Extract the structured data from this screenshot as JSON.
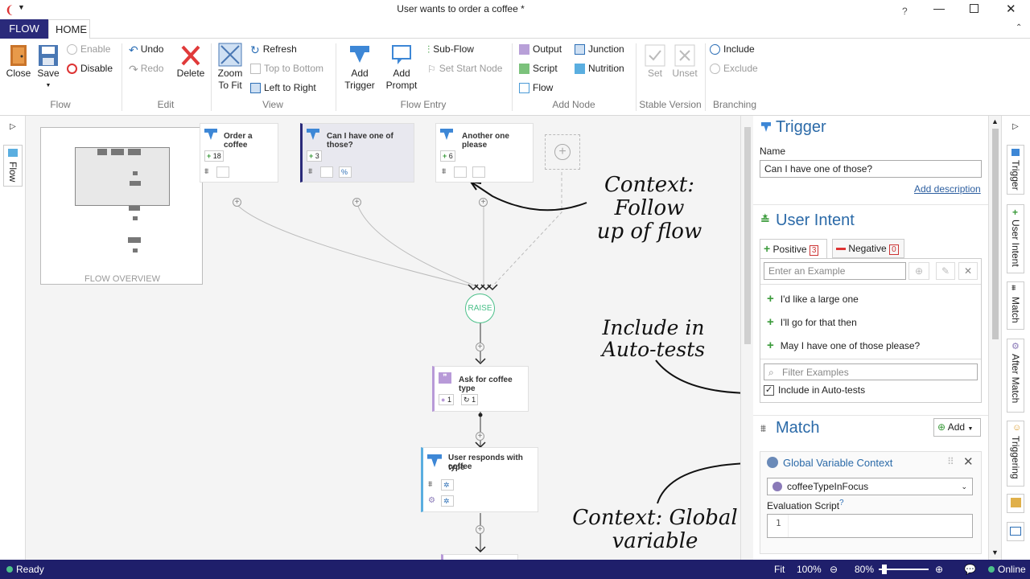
{
  "window": {
    "title": "User wants to order a coffee *"
  },
  "ribbon_tabs": [
    "FLOW",
    "HOME"
  ],
  "ribbon": {
    "close": "Close",
    "save": "Save",
    "enable": "Enable",
    "disable": "Disable",
    "undo": "Undo",
    "redo": "Redo",
    "delete": "Delete",
    "zoom_to_fit": [
      "Zoom",
      "To Fit"
    ],
    "refresh": "Refresh",
    "top_to_bottom": "Top to Bottom",
    "left_to_right": "Left to Right",
    "add_trigger": [
      "Add",
      "Trigger"
    ],
    "add_prompt": [
      "Add",
      "Prompt"
    ],
    "sub_flow": "Sub-Flow",
    "set_start_node": "Set Start Node",
    "output": "Output",
    "script": "Script",
    "flow": "Flow",
    "junction": "Junction",
    "nutrition": "Nutrition",
    "set": "Set",
    "unset": "Unset",
    "include": "Include",
    "exclude": "Exclude",
    "groups": [
      "Flow",
      "Edit",
      "View",
      "Flow Entry",
      "Add Node",
      "Stable Version",
      "Branching"
    ]
  },
  "left_rail": {
    "flow_tab": "Flow"
  },
  "overview": {
    "label": "FLOW OVERVIEW"
  },
  "nodes": {
    "trigger1": {
      "title": "Order a coffee",
      "count": "18"
    },
    "trigger2": {
      "title": "Can I have one of those?",
      "count": "3"
    },
    "trigger3": {
      "title": "Another one please",
      "count": "6"
    },
    "raise": "RAISE",
    "prompt": {
      "title": "Ask for coffee type",
      "a": "1",
      "b": "1"
    },
    "responds": {
      "title": [
        "User responds with coffee",
        "type"
      ]
    }
  },
  "annotations": {
    "context_follow": [
      "Context: Follow",
      "up of flow"
    ],
    "include_auto": [
      "Include in",
      "Auto-tests"
    ],
    "context_global": [
      "Context: Global",
      "variable"
    ]
  },
  "panel": {
    "trigger": {
      "heading": "Trigger",
      "name_label": "Name",
      "name_value": "Can I have one of those?",
      "add_description": "Add description"
    },
    "user_intent": {
      "heading": "User Intent",
      "positive_label": "Positive",
      "positive_count": "3",
      "negative_label": "Negative",
      "negative_count": "0",
      "example_placeholder": "Enter an Example",
      "examples": [
        "I'd like a large one",
        "I'll go for that then",
        "May I have one of those please?"
      ],
      "filter_placeholder": "Filter Examples",
      "include_label": "Include in Auto-tests",
      "include_checked": true
    },
    "match": {
      "heading": "Match",
      "add": "Add",
      "card_title": "Global Variable Context",
      "variable": "coffeeTypeInFocus",
      "eval_label": "Evaluation Script",
      "help": "?",
      "line_no": "1"
    }
  },
  "right_rail": [
    "Trigger",
    "User Intent",
    "Match",
    "After Match",
    "Triggering"
  ],
  "status": {
    "left": "Ready",
    "fit": "Fit",
    "zoom_a": "100%",
    "zoom_b": "80%",
    "online": "Online"
  }
}
